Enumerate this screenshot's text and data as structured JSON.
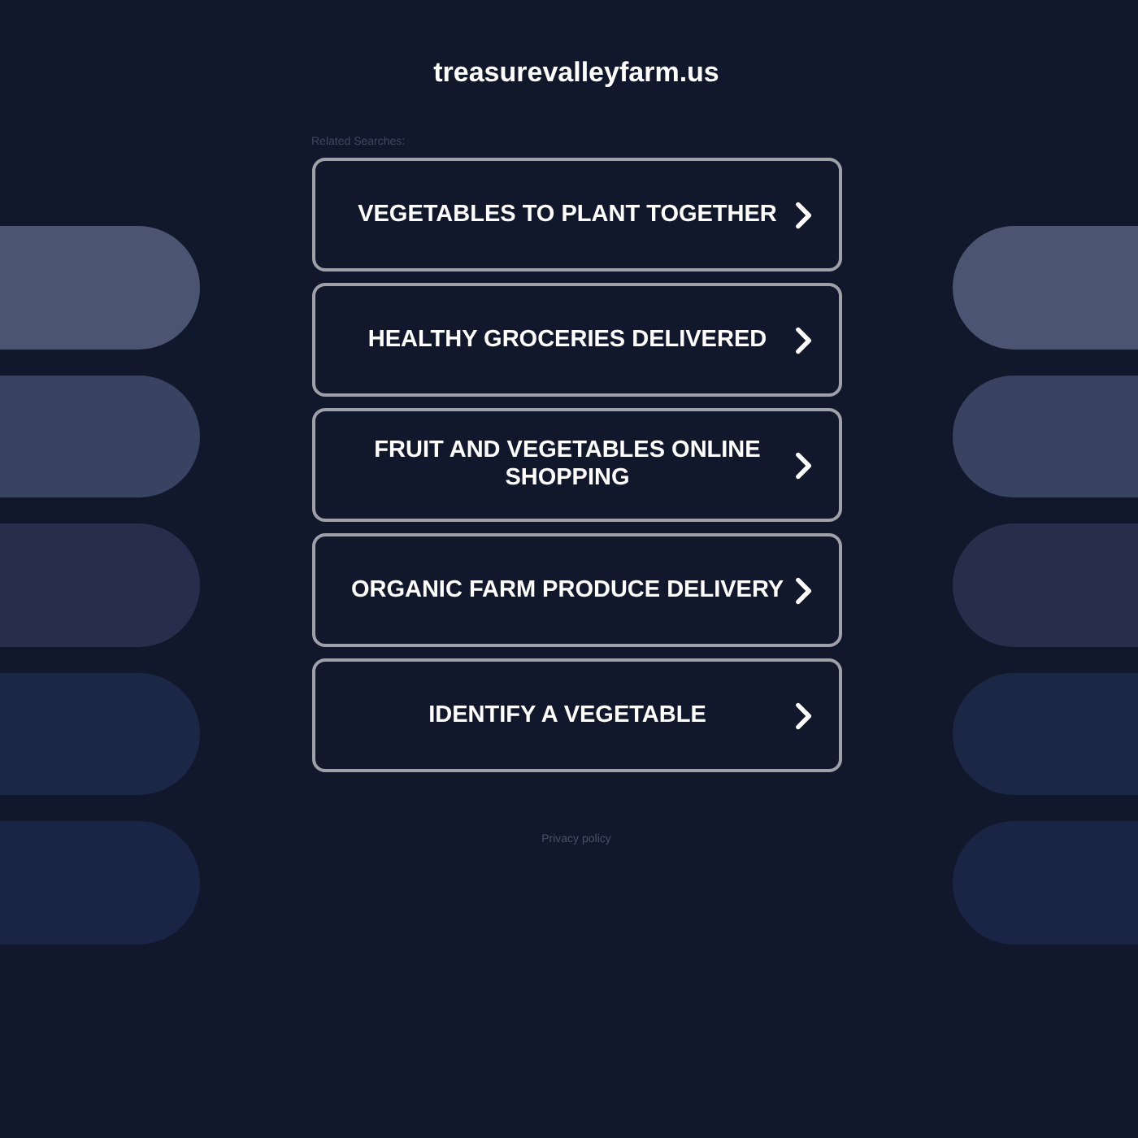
{
  "header": {
    "title": "treasurevalleyfarm.us"
  },
  "related_searches": {
    "heading": "Related Searches:",
    "links": [
      "VEGETABLES TO PLANT TOGETHER",
      "HEALTHY GROCERIES DELIVERED",
      "FRUIT AND VEGETABLES ONLINE SHOPPING",
      "ORGANIC FARM PRODUCE DELIVERY",
      "IDENTIFY A VEGETABLE"
    ]
  },
  "footer": {
    "privacy_link": "Privacy policy"
  }
}
